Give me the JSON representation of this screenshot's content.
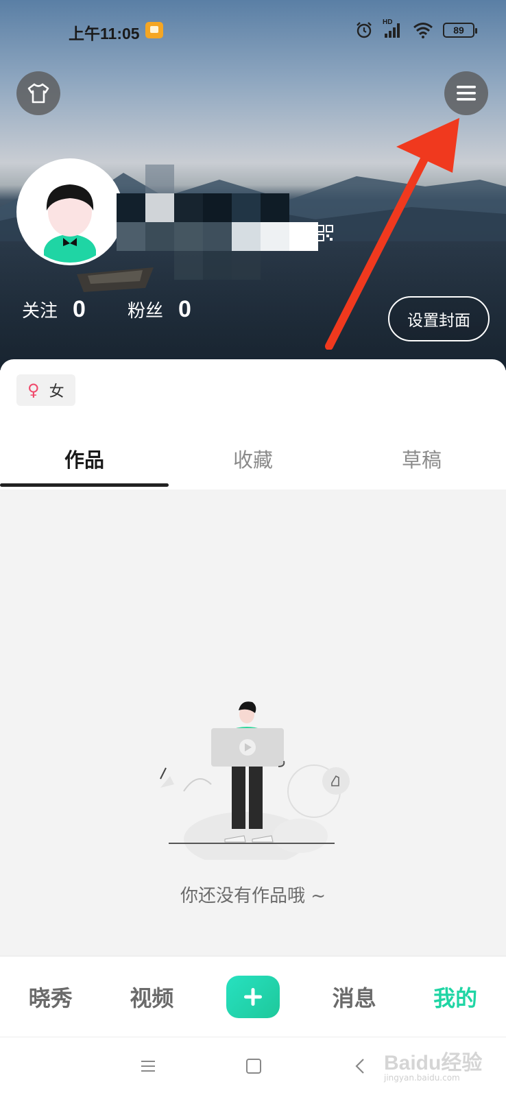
{
  "status_bar": {
    "time": "上午11:05",
    "hd_label": "HD",
    "battery": "89"
  },
  "header": {
    "follow_label": "关注",
    "follow_count": "0",
    "fans_label": "粉丝",
    "fans_count": "0",
    "set_cover_label": "设置封面"
  },
  "profile": {
    "gender_symbol": "♀",
    "gender_label": "女"
  },
  "tabs": [
    {
      "label": "作品",
      "active": true
    },
    {
      "label": "收藏",
      "active": false
    },
    {
      "label": "草稿",
      "active": false
    }
  ],
  "empty_state": {
    "message": "你还没有作品哦 ~"
  },
  "bottom_nav": {
    "items": [
      {
        "label": "晓秀",
        "active": false
      },
      {
        "label": "视频",
        "active": false
      },
      {
        "label": "消息",
        "active": false
      },
      {
        "label": "我的",
        "active": true
      }
    ]
  },
  "watermark": {
    "main": "Baidu经验",
    "sub": "jingyan.baidu.com"
  },
  "colors": {
    "accent": "#1fd5a4",
    "annotation_arrow": "#f0391e",
    "female": "#f0496b"
  }
}
